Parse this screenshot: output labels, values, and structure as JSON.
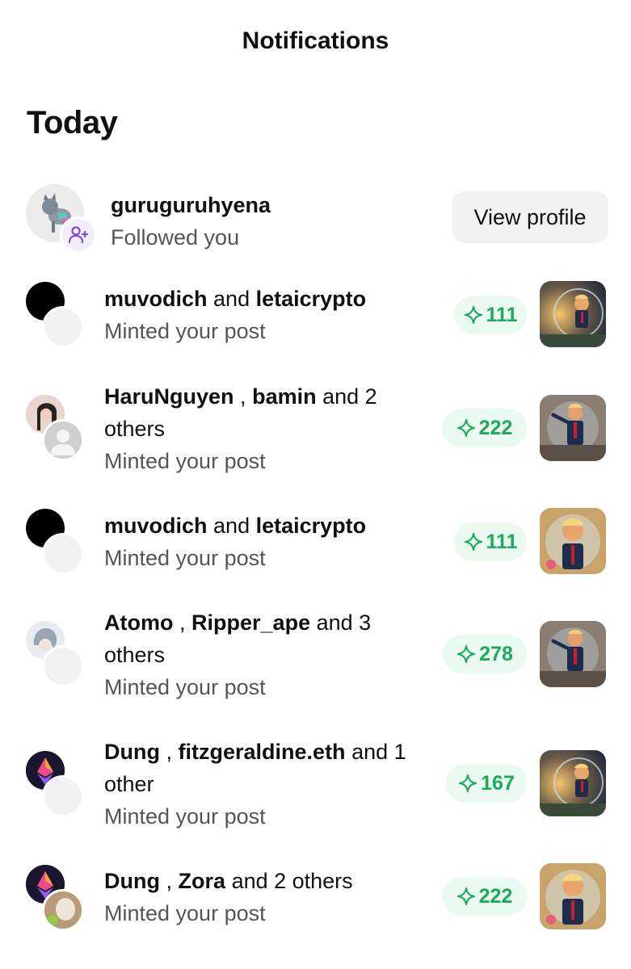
{
  "header": {
    "title": "Notifications"
  },
  "section": {
    "title": "Today"
  },
  "follow": {
    "username": "guruguruhyena",
    "action": "Followed you",
    "button_label": "View profile"
  },
  "mints": [
    {
      "names": [
        "muvodich",
        "letaicrypto"
      ],
      "connector": "and",
      "suffix": "",
      "action": "Minted your post",
      "count": "111"
    },
    {
      "names": [
        "HaruNguyen",
        "bamin"
      ],
      "connector": ",",
      "suffix": "and 2 others",
      "action": "Minted your post",
      "count": "222"
    },
    {
      "names": [
        "muvodich",
        "letaicrypto"
      ],
      "connector": "and",
      "suffix": "",
      "action": "Minted your post",
      "count": "111"
    },
    {
      "names": [
        "Atomo",
        "Ripper_ape"
      ],
      "connector": ",",
      "suffix": "and 3 others",
      "action": "Minted your post",
      "count": "278"
    },
    {
      "names": [
        "Dung",
        "fitzgeraldine.eth"
      ],
      "connector": ",",
      "suffix": "and 1 other",
      "action": "Minted your post",
      "count": "167"
    },
    {
      "names": [
        "Dung",
        "Zora"
      ],
      "connector": ",",
      "suffix": "and 2 others",
      "action": "Minted your post",
      "count": "222"
    }
  ],
  "colors": {
    "accent_green": "#1fa95f",
    "pill_bg": "#eafaf1",
    "follow_badge": "#7c4ddc"
  }
}
